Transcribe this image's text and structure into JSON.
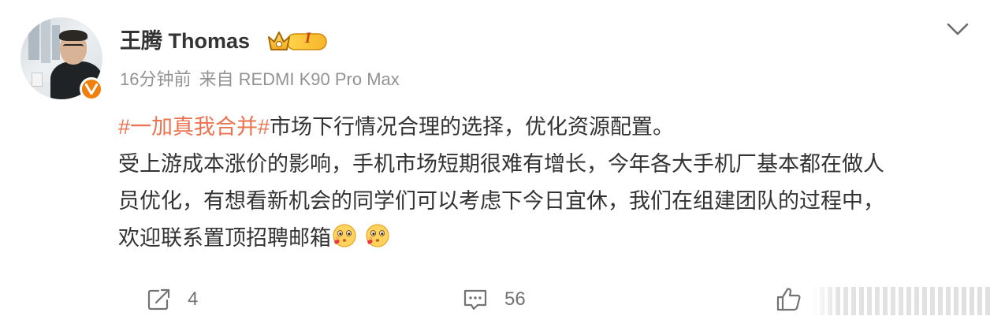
{
  "user": {
    "name": "王腾 Thomas",
    "vip_level": "I"
  },
  "meta": {
    "time": "16分钟前",
    "source": "来自 REDMI K90 Pro Max"
  },
  "post": {
    "topic": "#一加真我合并#",
    "line1_rest": "市场下行情况合理的选择，优化资源配置。",
    "line2": "受上游成本涨价的影响，手机市场短期很难有增长，今年各大手机厂基本都在做人",
    "line3": "员优化，有想看新机会的同学们可以考虑下今日宜休，我们在组建团队的过程中，",
    "line4": "欢迎联系置顶招聘邮箱"
  },
  "actions": {
    "repost_count": "4",
    "comment_count": "56"
  },
  "colors": {
    "topic": "#eb7350",
    "verified_badge": "#f07f0d",
    "meta_text": "#939393",
    "action_text": "#737373"
  },
  "icons": [
    "chevron-down-icon",
    "verified-v-icon",
    "vip-crown-icon",
    "repost-icon",
    "comment-icon",
    "like-icon",
    "kiss-emoji-icon"
  ]
}
